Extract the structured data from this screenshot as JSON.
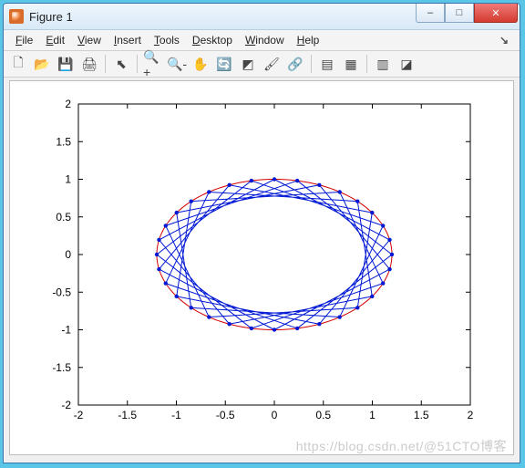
{
  "window": {
    "title": "Figure 1",
    "buttons": {
      "min": "–",
      "max": "□",
      "close": "✕"
    }
  },
  "menu": {
    "file": "File",
    "edit": "Edit",
    "view": "View",
    "insert": "Insert",
    "tools": "Tools",
    "desktop": "Desktop",
    "window_": "Window",
    "help": "Help",
    "dock": "↘"
  },
  "toolbar": {
    "new": "🗋",
    "open": "📂",
    "save": "💾",
    "print": "🖨",
    "pointer": "⬉",
    "zoomin": "🔍+",
    "zoomout": "🔍-",
    "pan": "✋",
    "rotate": "🔄",
    "datacursor": "◩",
    "brush": "🖌",
    "link": "🔗",
    "colorbar": "▤",
    "legend": "▦",
    "hide": "▥",
    "dock2": "◪"
  },
  "watermark": "https://blog.csdn.net/@51CTO博客",
  "chart_data": {
    "type": "line",
    "title": "",
    "xlabel": "",
    "ylabel": "",
    "xlim": [
      -2,
      2
    ],
    "ylim": [
      -2,
      2
    ],
    "xticks": [
      -2,
      -1.5,
      -1,
      -0.5,
      0,
      0.5,
      1,
      1.5,
      2
    ],
    "yticks": [
      -2,
      -1.5,
      -1,
      -0.5,
      0,
      0.5,
      1,
      1.5,
      2
    ],
    "series": [
      {
        "name": "circle",
        "style": "red-line",
        "description": "unit circle scaled a=1.2 b=1.0",
        "a": 1.2,
        "b": 1.0
      },
      {
        "name": "chords",
        "style": "blue-line-marker",
        "description": "32 points on ellipse, each connected to the point 7 steps ahead",
        "n_points": 32,
        "skip": 7,
        "a": 1.2,
        "b": 1.0,
        "points": [
          [
            1.2,
            0.0
          ],
          [
            1.177,
            0.195
          ],
          [
            1.109,
            0.383
          ],
          [
            0.998,
            0.556
          ],
          [
            0.849,
            0.707
          ],
          [
            0.667,
            0.831
          ],
          [
            0.459,
            0.924
          ],
          [
            0.234,
            0.981
          ],
          [
            0.0,
            1.0
          ],
          [
            -0.234,
            0.981
          ],
          [
            -0.459,
            0.924
          ],
          [
            -0.667,
            0.831
          ],
          [
            -0.849,
            0.707
          ],
          [
            -0.998,
            0.556
          ],
          [
            -1.109,
            0.383
          ],
          [
            -1.177,
            0.195
          ],
          [
            -1.2,
            0.0
          ],
          [
            -1.177,
            -0.195
          ],
          [
            -1.109,
            -0.383
          ],
          [
            -0.998,
            -0.556
          ],
          [
            -0.849,
            -0.707
          ],
          [
            -0.667,
            -0.831
          ],
          [
            -0.459,
            -0.924
          ],
          [
            -0.234,
            -0.981
          ],
          [
            0.0,
            -1.0
          ],
          [
            0.234,
            -0.981
          ],
          [
            0.459,
            -0.924
          ],
          [
            0.667,
            -0.831
          ],
          [
            0.849,
            -0.707
          ],
          [
            0.998,
            -0.556
          ],
          [
            1.109,
            -0.383
          ],
          [
            1.177,
            -0.195
          ]
        ]
      }
    ]
  }
}
